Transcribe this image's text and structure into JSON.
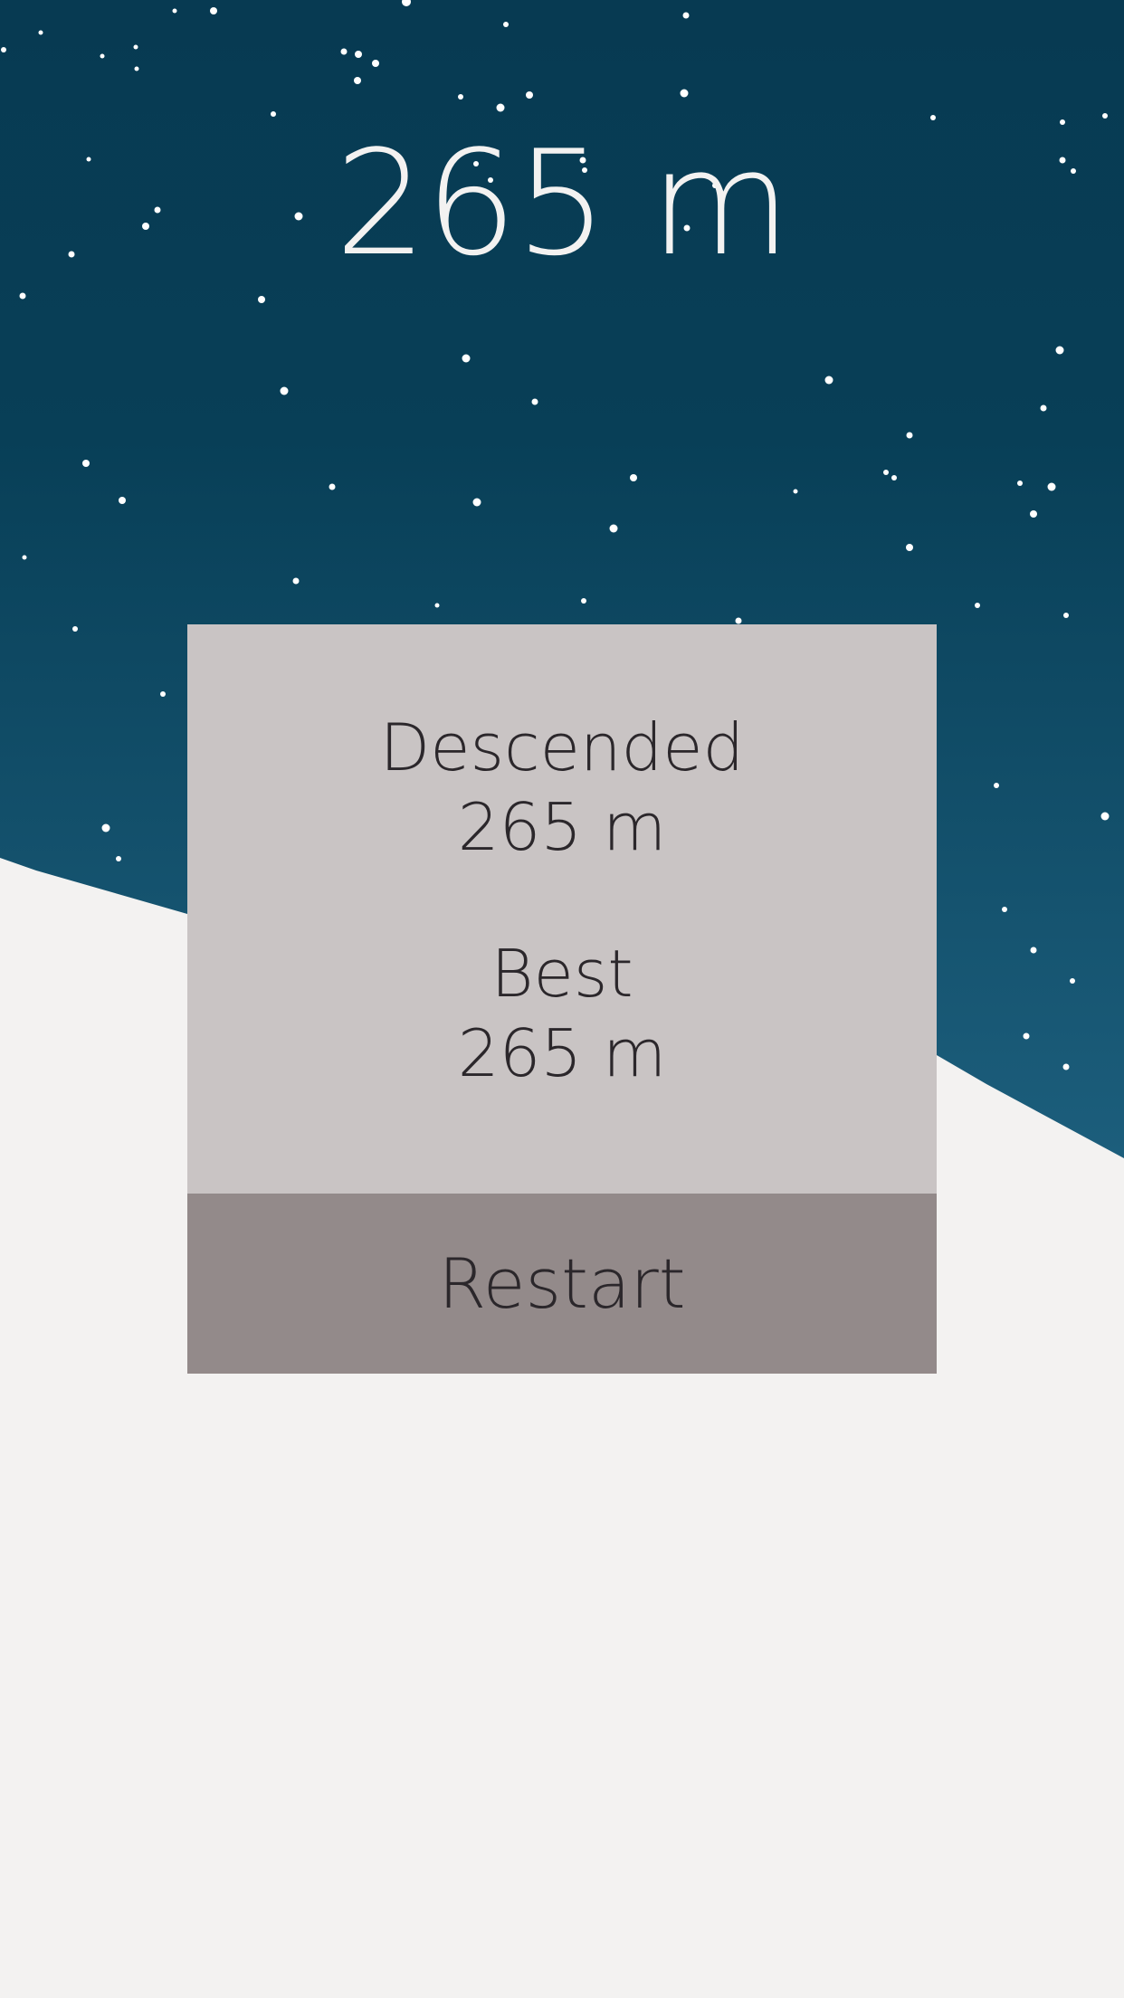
{
  "hud": {
    "distance": "265 m"
  },
  "game_over": {
    "descended_label": "Descended",
    "descended_value": "265 m",
    "best_label": "Best",
    "best_value": "265 m",
    "restart_label": "Restart"
  },
  "colors": {
    "sky_top": "#073a52",
    "sky_bottom": "#1c5e7c",
    "snow": "#f3f2f1",
    "star": "#ffffff",
    "hud_text": "#f3f2f1",
    "panel_bg": "#c9c4c4",
    "button_bg": "#938a8a",
    "panel_text": "#2b272b"
  }
}
